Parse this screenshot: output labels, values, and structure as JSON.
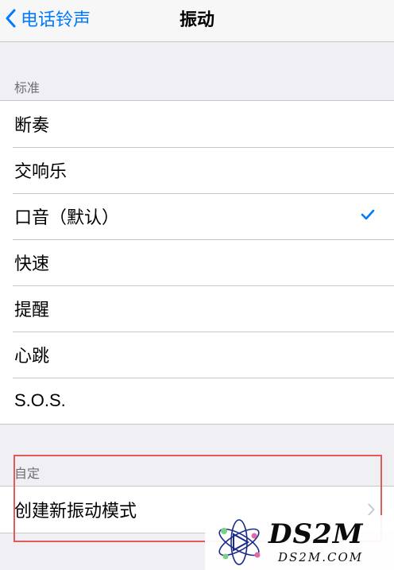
{
  "nav": {
    "back_label": "电话铃声",
    "title": "振动"
  },
  "standard": {
    "header": "标准",
    "items": [
      {
        "label": "断奏",
        "selected": false
      },
      {
        "label": "交响乐",
        "selected": false
      },
      {
        "label": "口音（默认）",
        "selected": true
      },
      {
        "label": "快速",
        "selected": false
      },
      {
        "label": "提醒",
        "selected": false
      },
      {
        "label": "心跳",
        "selected": false
      },
      {
        "label": "S.O.S.",
        "selected": false
      }
    ]
  },
  "custom": {
    "header": "自定",
    "create_label": "创建新振动模式"
  },
  "watermark": {
    "title": "DS2M",
    "subtitle": "DS2M.COM"
  },
  "colors": {
    "accent": "#007aff",
    "highlight_border": "#e25a5a",
    "background": "#efeff4"
  }
}
